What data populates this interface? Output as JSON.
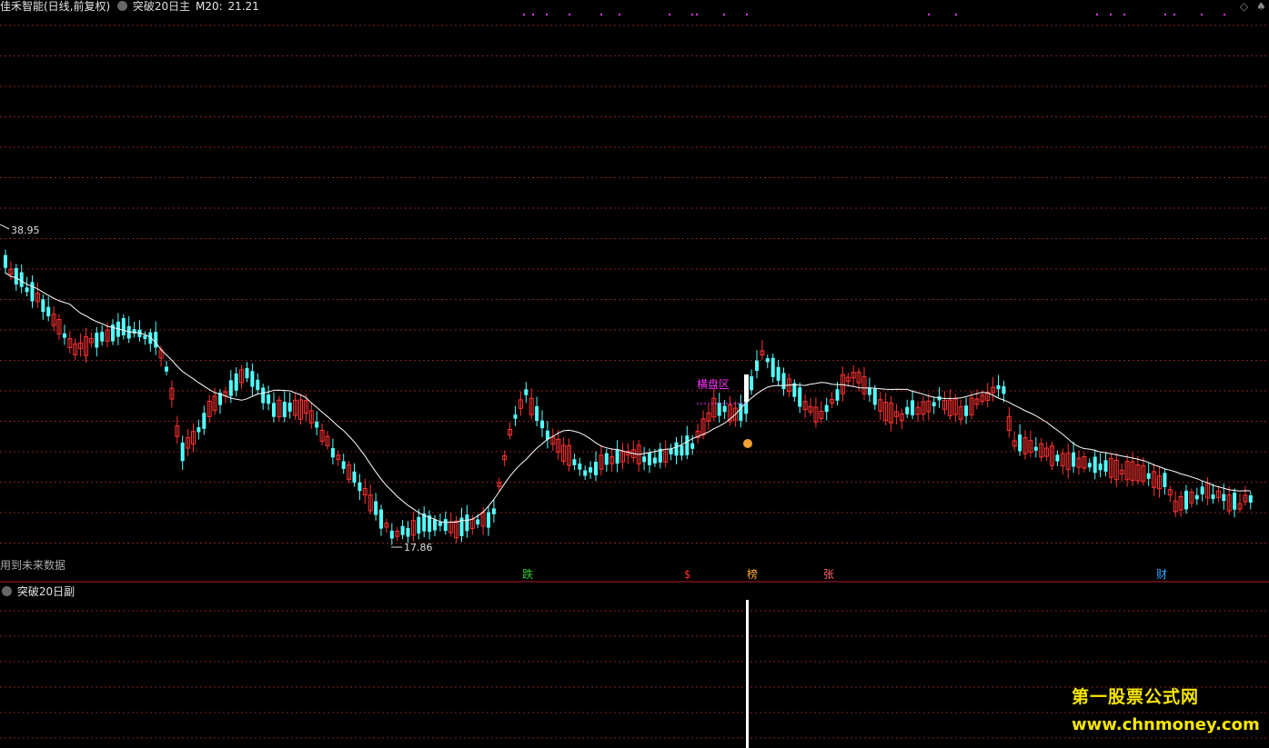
{
  "header": {
    "stock_name": "佳禾智能(日线,前复权)",
    "indicator_name": "突破20日主",
    "ma_label": "M20:",
    "ma_value": "21.21",
    "corner_icons": [
      "◇",
      "♠"
    ]
  },
  "chart": {
    "high_label": "38.95",
    "low_label": "17.86",
    "range_label": "横盘区",
    "future_note": "用到未来数据",
    "signals": [
      {
        "label": "跌",
        "color": "#33cc33"
      },
      {
        "label": "$",
        "color": "#ff3333"
      },
      {
        "label": "榜",
        "color": "#ffaa33"
      },
      {
        "label": "张",
        "color": "#ff6666"
      },
      {
        "label": "财",
        "color": "#33aaff"
      }
    ],
    "colors": {
      "up": "#ff3232",
      "down": "#54ffff",
      "ma": "#ffffff",
      "grid": "#8a1f1f",
      "label": "#ff33ff"
    }
  },
  "sub_panel": {
    "title": "突破20日副"
  },
  "watermark": {
    "line1": "第一股票公式网",
    "line2": "www.chnmoney.com"
  }
}
